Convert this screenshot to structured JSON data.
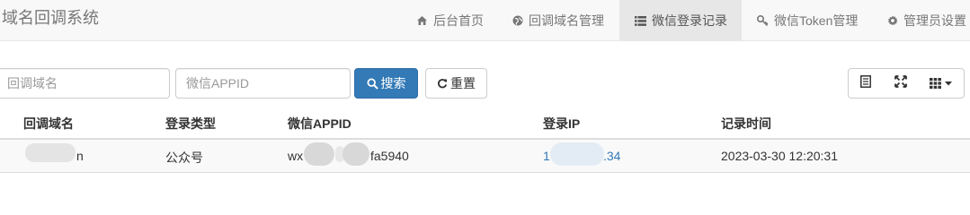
{
  "app": {
    "title": "域名回调系统"
  },
  "nav": [
    {
      "label": "后台首页",
      "icon": "home-icon",
      "active": false
    },
    {
      "label": "回调域名管理",
      "icon": "globe-icon",
      "active": false
    },
    {
      "label": "微信登录记录",
      "icon": "list-icon",
      "active": true
    },
    {
      "label": "微信Token管理",
      "icon": "key-icon",
      "active": false
    },
    {
      "label": "管理员设置",
      "icon": "gear-icon",
      "active": false
    }
  ],
  "search": {
    "domain_placeholder": "回调域名",
    "appid_placeholder": "微信APPID",
    "search_label": "搜索",
    "reset_label": "重置"
  },
  "toolbar": {
    "icons": [
      "list-view-icon",
      "fullscreen-icon",
      "columns-icon"
    ]
  },
  "table": {
    "headers": [
      "回调域名",
      "登录类型",
      "微信APPID",
      "登录IP",
      "记录时间"
    ],
    "rows": [
      {
        "domain": "n",
        "type": "公众号",
        "appid_prefix": "wx",
        "appid_suffix": "fa5940",
        "ip_prefix": "1",
        "ip_suffix": ".34",
        "time": "2023-03-30 12:20:31"
      }
    ]
  },
  "colors": {
    "primary": "#337ab7",
    "navbar_bg": "#f8f8f8",
    "active_nav_bg": "#e7e7e7",
    "link": "#337ab7"
  }
}
